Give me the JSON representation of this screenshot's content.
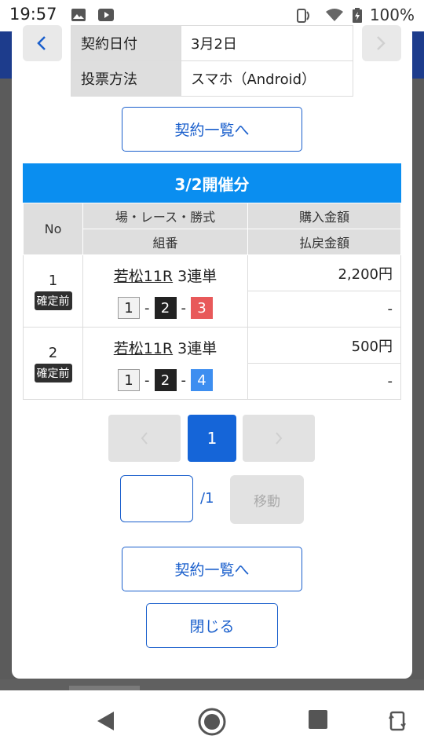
{
  "status_bar": {
    "time": "19:57",
    "battery": "100%"
  },
  "info": {
    "rows": [
      {
        "label": "契約日付",
        "value": "3月2日"
      },
      {
        "label": "投票方法",
        "value": "スマホ（Android）"
      }
    ]
  },
  "buttons": {
    "contract_list_top": "契約一覧へ",
    "contract_list_bottom": "契約一覧へ",
    "close": "閉じる",
    "move": "移動"
  },
  "section": {
    "title": "3/2開催分"
  },
  "bet_table": {
    "header": {
      "no": "No",
      "race": "場・レース・勝式",
      "purchase": "購入金額",
      "combo": "組番",
      "payout": "払戻金額"
    },
    "rows": [
      {
        "no": "1",
        "status": "確定前",
        "venue_race": "若松11R",
        "bet_type": "3連単",
        "combo": [
          "1",
          "2",
          "3"
        ],
        "purchase": "2,200円",
        "payout": "-"
      },
      {
        "no": "2",
        "status": "確定前",
        "venue_race": "若松11R",
        "bet_type": "3連単",
        "combo": [
          "1",
          "2",
          "4"
        ],
        "purchase": "500円",
        "payout": "-"
      }
    ]
  },
  "pagination": {
    "current": "1",
    "input_value": "",
    "total": "/1"
  },
  "colors": {
    "accent": "#1a5fcc",
    "section_header": "#0a8ef0",
    "page_active": "#1565d8",
    "boat_1": "#f2f2f2",
    "boat_2": "#222222",
    "boat_3": "#e8595a",
    "boat_4": "#3d8ef0"
  }
}
